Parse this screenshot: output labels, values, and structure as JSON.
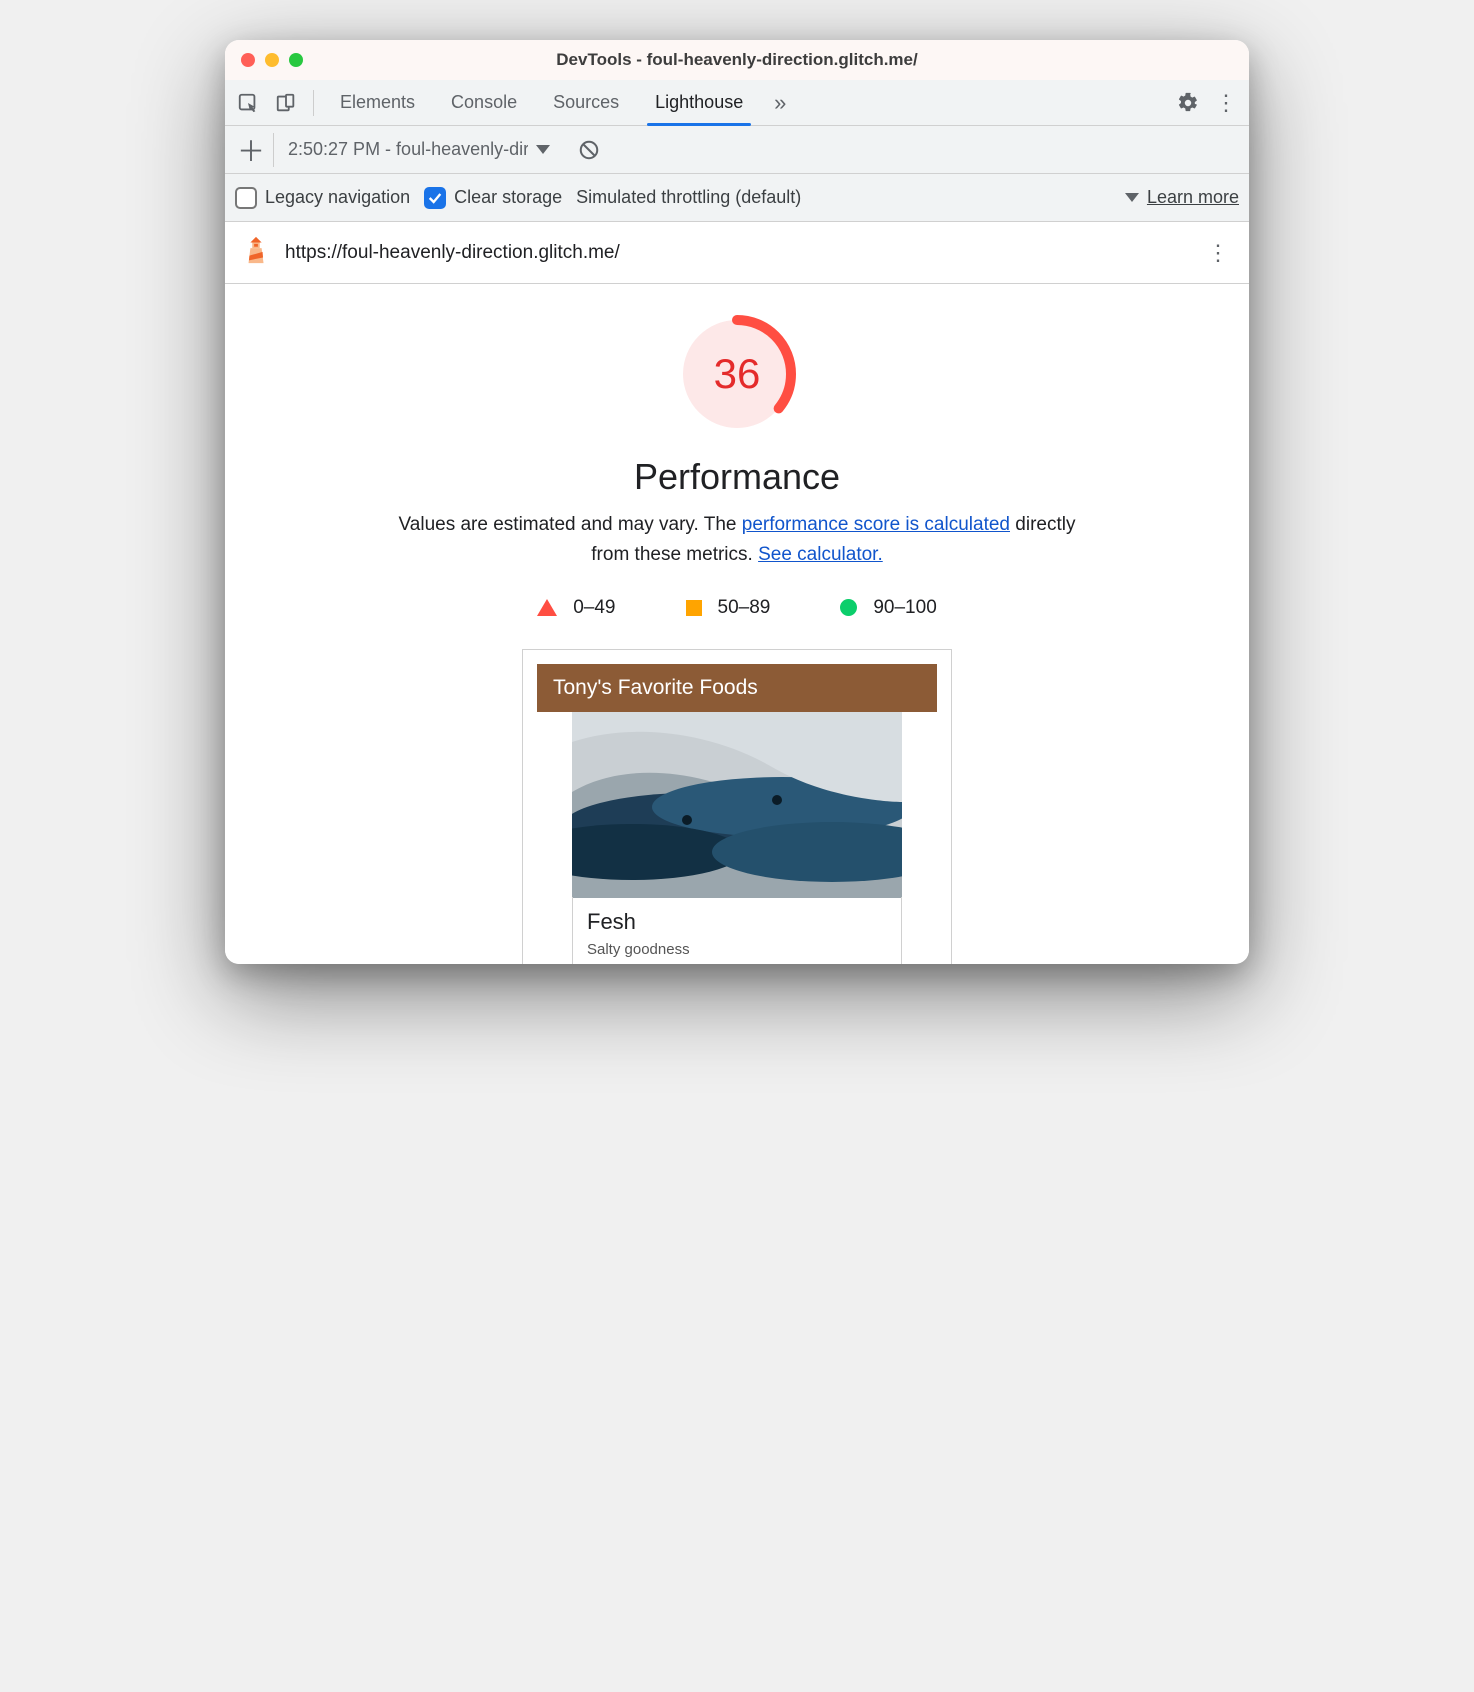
{
  "window": {
    "title": "DevTools - foul-heavenly-direction.glitch.me/"
  },
  "tabs": {
    "elements": "Elements",
    "console": "Console",
    "sources": "Sources",
    "lighthouse": "Lighthouse"
  },
  "subbar": {
    "report_entry": "2:50:27 PM - foul-heavenly-dir"
  },
  "options": {
    "legacy_label": "Legacy navigation",
    "legacy_checked": false,
    "clear_label": "Clear storage",
    "clear_checked": true,
    "throttling_label": "Simulated throttling (default)",
    "learn_more": "Learn more"
  },
  "report": {
    "url": "https://foul-heavenly-direction.glitch.me/",
    "score": "36",
    "heading": "Performance",
    "note_before": "Values are estimated and may vary. The ",
    "note_link1": "performance score is calculated",
    "note_mid": " directly from these metrics. ",
    "note_link2": "See calculator.",
    "legend": {
      "low": "0–49",
      "mid": "50–89",
      "high": "90–100"
    }
  },
  "preview": {
    "header": "Tony's Favorite Foods",
    "item_title": "Fesh",
    "item_sub": "Salty goodness"
  }
}
